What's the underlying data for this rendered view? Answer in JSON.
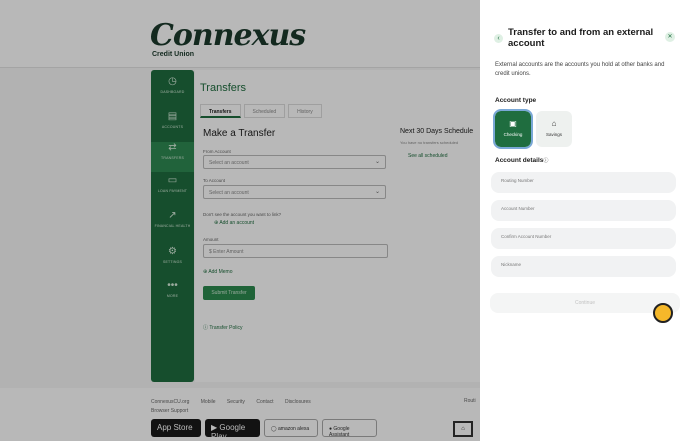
{
  "brand": {
    "logo_text": "Connexus",
    "logo_sub": "Credit Union"
  },
  "sidebar": {
    "items": [
      {
        "icon": "dashboard-icon",
        "glyph": "◷",
        "label": "DASHBOARD"
      },
      {
        "icon": "accounts-icon",
        "glyph": "▤",
        "label": "ACCOUNTS"
      },
      {
        "icon": "transfers-icon",
        "glyph": "⇄",
        "label": "TRANSFERS"
      },
      {
        "icon": "loan-payment-icon",
        "glyph": "▭",
        "label": "LOAN PAYMENT"
      },
      {
        "icon": "financial-health-icon",
        "glyph": "↗",
        "label": "FINANCIAL HEALTH"
      },
      {
        "icon": "settings-icon",
        "glyph": "⚙",
        "label": "SETTINGS"
      },
      {
        "icon": "more-icon",
        "glyph": "•••",
        "label": "MORE"
      }
    ]
  },
  "main": {
    "title": "Transfers",
    "tabs": [
      "Transfers",
      "Scheduled",
      "History"
    ],
    "section_title": "Make a Transfer",
    "from_label": "From Account",
    "from_placeholder": "Select an account",
    "to_label": "To Account",
    "to_placeholder": "Select an account",
    "hint": "Don't see the account you want to link?",
    "add_account": "Add an account",
    "amount_label": "Amount",
    "amount_placeholder": "Enter Amount",
    "add_memo": "Add Memo",
    "submit": "Submit Transfer",
    "policy": "Transfer Policy",
    "next_title": "Next 30 Days Schedule",
    "next_sub": "You have no transfers scheduled",
    "next_link": "See all scheduled"
  },
  "footer": {
    "links": [
      "ConnexusCU.org",
      "Mobile",
      "Security",
      "Contact",
      "Disclosures"
    ],
    "sub": "Browser Support",
    "right": "Routi",
    "badges": [
      "App Store",
      "Google Play",
      "amazon alexa",
      "Google Assistant"
    ]
  },
  "panel": {
    "title": "Transfer to and from an external account",
    "description": "External accounts are the accounts you hold at other banks and credit unions.",
    "account_type_heading": "Account type",
    "account_types": [
      {
        "label": "Checking",
        "glyph": "▣",
        "selected": true
      },
      {
        "label": "Savings",
        "glyph": "⌂",
        "selected": false
      }
    ],
    "details_heading": "Account details",
    "fields": [
      "Routing Number",
      "Account Number",
      "Confirm Account Number",
      "Nickname"
    ],
    "continue_label": "Continue"
  },
  "colors": {
    "brand_green": "#1f6d3f",
    "selected_outline": "#7aa8d6",
    "cursor_dot": "#f5b82a"
  }
}
